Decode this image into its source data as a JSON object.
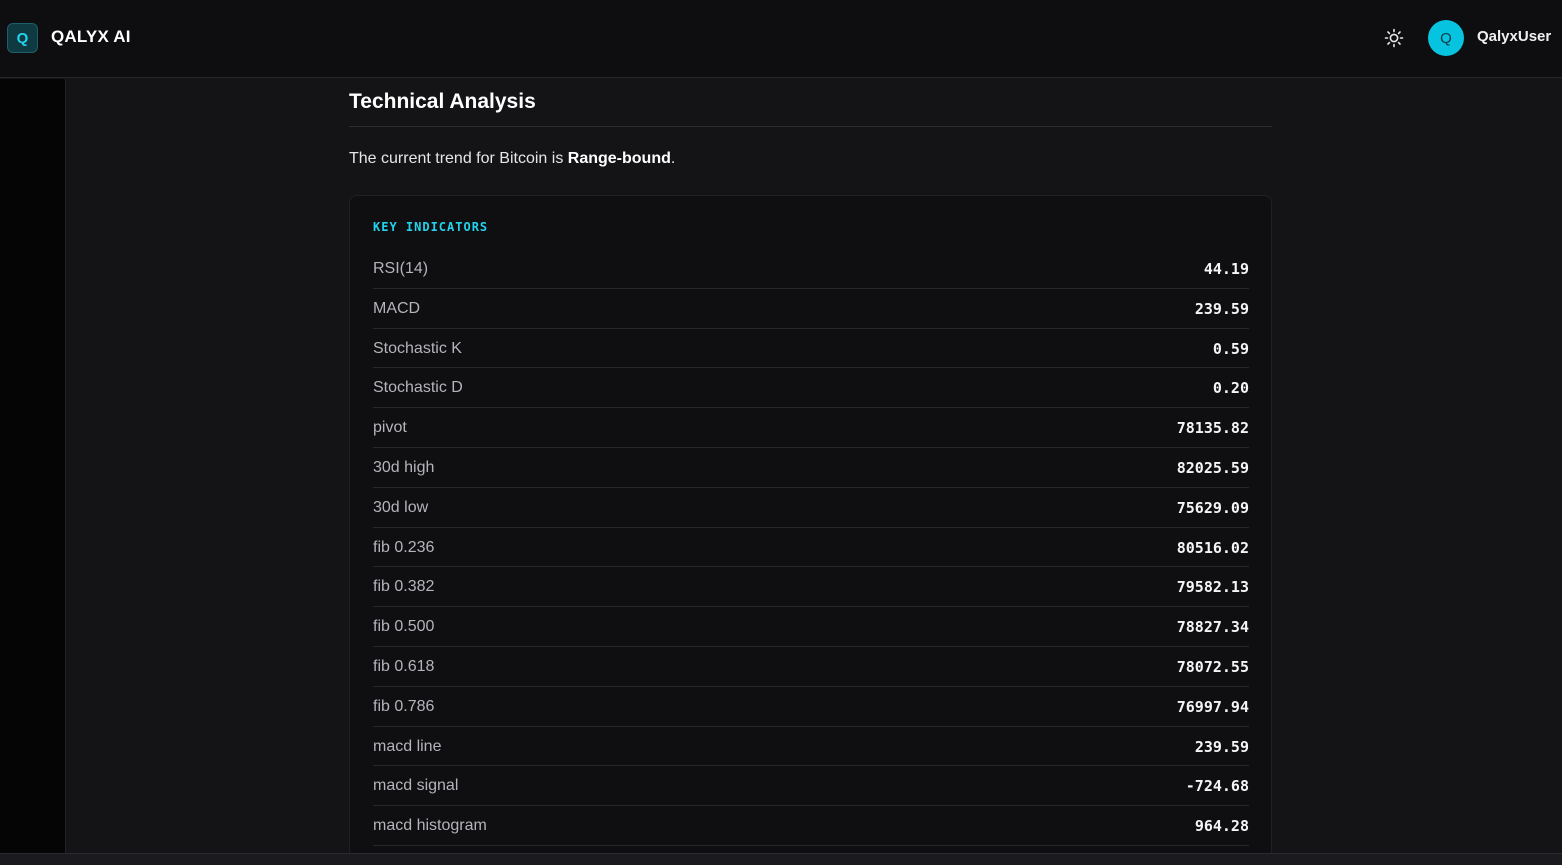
{
  "header": {
    "logo_letter": "Q",
    "app_title": "QALYX AI",
    "theme_icon": "sun-icon",
    "avatar_letter": "Q",
    "username": "QalyxUser"
  },
  "analysis": {
    "title": "Technical Analysis",
    "trend_prefix": "The current trend for Bitcoin is ",
    "trend_value": "Range-bound",
    "trend_suffix": ".",
    "indicators_label": "KEY INDICATORS",
    "indicators": [
      {
        "name": "RSI(14)",
        "value": "44.19"
      },
      {
        "name": "MACD",
        "value": "239.59"
      },
      {
        "name": "Stochastic K",
        "value": "0.59"
      },
      {
        "name": "Stochastic D",
        "value": "0.20"
      },
      {
        "name": "pivot",
        "value": "78135.82"
      },
      {
        "name": "30d high",
        "value": "82025.59"
      },
      {
        "name": "30d low",
        "value": "75629.09"
      },
      {
        "name": "fib 0.236",
        "value": "80516.02"
      },
      {
        "name": "fib 0.382",
        "value": "79582.13"
      },
      {
        "name": "fib 0.500",
        "value": "78827.34"
      },
      {
        "name": "fib 0.618",
        "value": "78072.55"
      },
      {
        "name": "fib 0.786",
        "value": "76997.94"
      },
      {
        "name": "macd line",
        "value": "239.59"
      },
      {
        "name": "macd signal",
        "value": "-724.68"
      },
      {
        "name": "macd histogram",
        "value": "964.28"
      }
    ]
  },
  "colors": {
    "accent": "#22d3ee",
    "avatar": "#06c4e0",
    "background": "#141417",
    "topbar": "#0e0e10"
  }
}
